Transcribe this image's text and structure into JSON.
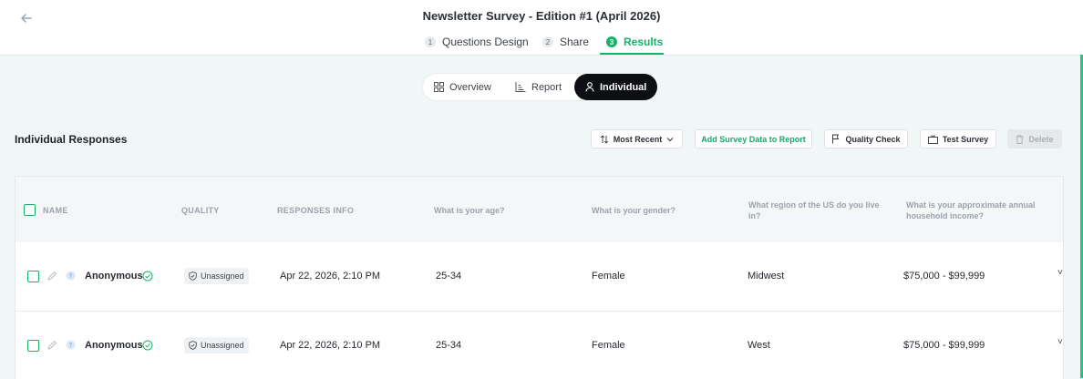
{
  "header": {
    "title": "Newsletter Survey - Edition #1 (April 2026)",
    "steps": [
      {
        "num": "1",
        "label": "Questions Design"
      },
      {
        "num": "2",
        "label": "Share"
      },
      {
        "num": "3",
        "label": "Results"
      }
    ],
    "active_step": "Results"
  },
  "view_tabs": [
    "Overview",
    "Report",
    "Individual"
  ],
  "active_view": "Individual",
  "section_title": "Individual Responses",
  "toolbar": {
    "sort_label": "Most Recent",
    "add_label": "Add Survey Data to Report",
    "quality_label": "Quality Check",
    "test_label": "Test Survey",
    "delete_label": "Delete"
  },
  "table": {
    "columns": [
      "NAME",
      "QUALITY",
      "RESPONSES INFO",
      "What is your age?",
      "What is your gender?",
      "What region of the US do you live in?",
      "What is your approximate annual household income?"
    ],
    "rows": [
      {
        "name": "Anonymous",
        "quality": "Unassigned",
        "date": "Apr 22, 2026, 2:10 PM",
        "age": "25-34",
        "gender": "Female",
        "region": "Midwest",
        "income": "$75,000 - $99,999"
      },
      {
        "name": "Anonymous",
        "quality": "Unassigned",
        "date": "Apr 22, 2026, 2:10 PM",
        "age": "25-34",
        "gender": "Female",
        "region": "West",
        "income": "$75,000 - $99,999"
      }
    ]
  },
  "colors": {
    "accent": "#17b26a",
    "dark": "#0d0f12"
  }
}
